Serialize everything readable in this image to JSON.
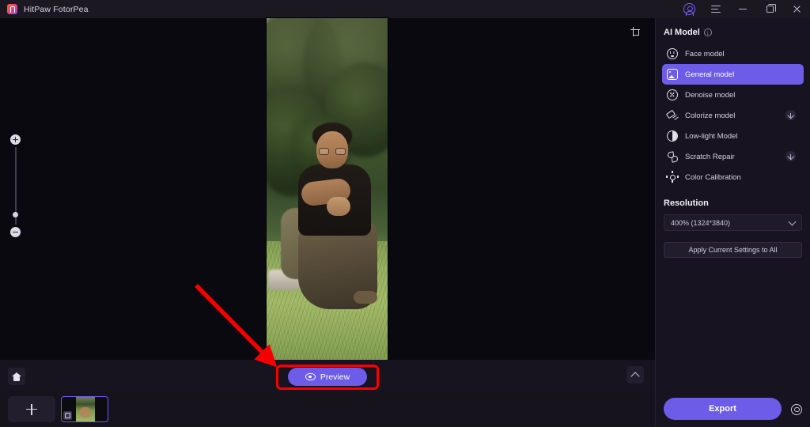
{
  "window": {
    "app_title": "HitPaw FotorPea",
    "logo_icon": "hitpaw-logo-icon",
    "controls": {
      "account_icon": "account-circle-icon",
      "menu_icon": "hamburger-menu-icon",
      "minimize_icon": "minimize-icon",
      "maximize_icon": "maximize-restore-icon",
      "close_icon": "close-icon"
    }
  },
  "canvas": {
    "crop_icon": "crop-icon",
    "zoom_slider": {
      "zoom_in_icon": "plus-icon",
      "zoom_out_icon": "minus-icon"
    },
    "photo_alt": "portrait photo of a person crouching on grass under trees"
  },
  "bottom_bar": {
    "preview_label": "Preview",
    "preview_icon": "eye-icon",
    "collapse_icon": "chevron-up-icon"
  },
  "filmstrip": {
    "home_icon": "home-icon",
    "add_icon": "plus-icon",
    "thumbnail_badge_icon": "image-badge-icon"
  },
  "panel": {
    "ai_model": {
      "title": "AI Model",
      "info_icon": "info-icon",
      "info_glyph": "i",
      "items": [
        {
          "label": "Face model",
          "icon": "face-model-icon",
          "selected": false,
          "download": false
        },
        {
          "label": "General model",
          "icon": "general-model-icon",
          "selected": true,
          "download": false
        },
        {
          "label": "Denoise model",
          "icon": "denoise-model-icon",
          "selected": false,
          "download": false
        },
        {
          "label": "Colorize model",
          "icon": "colorize-model-icon",
          "selected": false,
          "download": true
        },
        {
          "label": "Low-light Model",
          "icon": "low-light-model-icon",
          "selected": false,
          "download": false
        },
        {
          "label": "Scratch Repair",
          "icon": "scratch-repair-icon",
          "selected": false,
          "download": true
        },
        {
          "label": "Color Calibration",
          "icon": "color-calibration-icon",
          "selected": false,
          "download": false
        }
      ]
    },
    "resolution": {
      "title": "Resolution",
      "selected_value": "400% (1324*3840)",
      "dropdown_icon": "chevron-down-icon"
    },
    "apply_all_label": "Apply Current Settings to All",
    "export_label": "Export",
    "settings_icon": "gear-icon"
  },
  "annotations": {
    "arrow": "red-arrow-pointing-to-preview-button",
    "highlight_box": "red-rectangle-around-preview-button"
  },
  "colors": {
    "accent_purple": "#6c5ce7",
    "panel_bg": "#171320",
    "canvas_bg": "#0b0910",
    "titlebar_bg": "#1b1822",
    "annotation_red": "#f50000"
  }
}
